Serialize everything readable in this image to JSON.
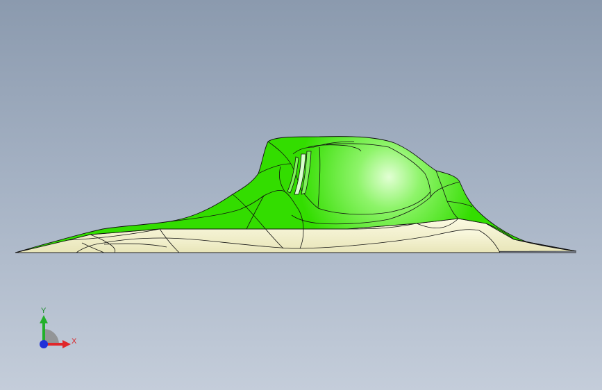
{
  "viewport": {
    "background_top": "#8b9aae",
    "background_bottom": "#c4cdda"
  },
  "model": {
    "name": "surface-model",
    "colors": {
      "surface_green": "#33dd00",
      "surface_highlight": "#c8ffb0",
      "base_cream": "#f4f2cf",
      "edge_lines": "#111111"
    }
  },
  "triad": {
    "y_label": "Y",
    "x_label": "X",
    "icon": "coordinate-triad-icon",
    "colors": {
      "y": "#22b02a",
      "x": "#e0262a",
      "z": "#2030d8"
    }
  }
}
